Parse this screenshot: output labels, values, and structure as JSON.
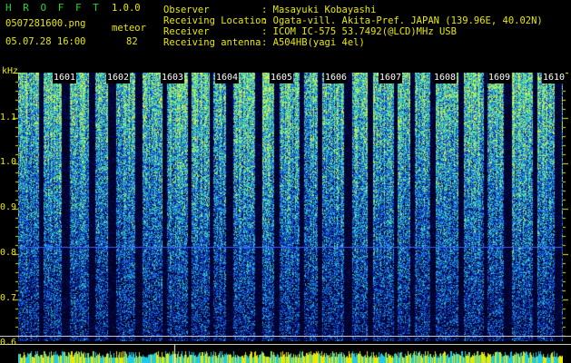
{
  "header": {
    "app_title": "H R O F F T",
    "version": "1.0.0",
    "filename": "0507281600.png",
    "mode": "meteor",
    "datetime": "05.07.28 16:00",
    "count": "82"
  },
  "info": {
    "labels": [
      "Observer",
      "Receiving Location",
      "Receiver",
      "Receiving antenna"
    ],
    "values": [
      ": Masayuki Kobayashi",
      ": Ogata-vill. Akita-Pref. JAPAN (139.96E, 40.02N)",
      ": ICOM IC-575 53.7492(@LCD)MHz USB",
      ": A504HB(yagi 4el)"
    ]
  },
  "axis": {
    "unit": "kHz",
    "ticks": [
      "1.1",
      "1.0",
      "0.9",
      "0.8",
      "0.7",
      "0.6"
    ]
  },
  "minutes": [
    "1601",
    "1602",
    "1603",
    "1604",
    "1605",
    "1606",
    "1607",
    "1608",
    "1609",
    "1610"
  ],
  "colors": {
    "text_yellow": "#e8e800",
    "title_green": "#2cd12c",
    "reference_line": "#3a64ff",
    "baseline_yellow": "#e8e800",
    "baseline_cyan": "#22c8e8"
  }
}
